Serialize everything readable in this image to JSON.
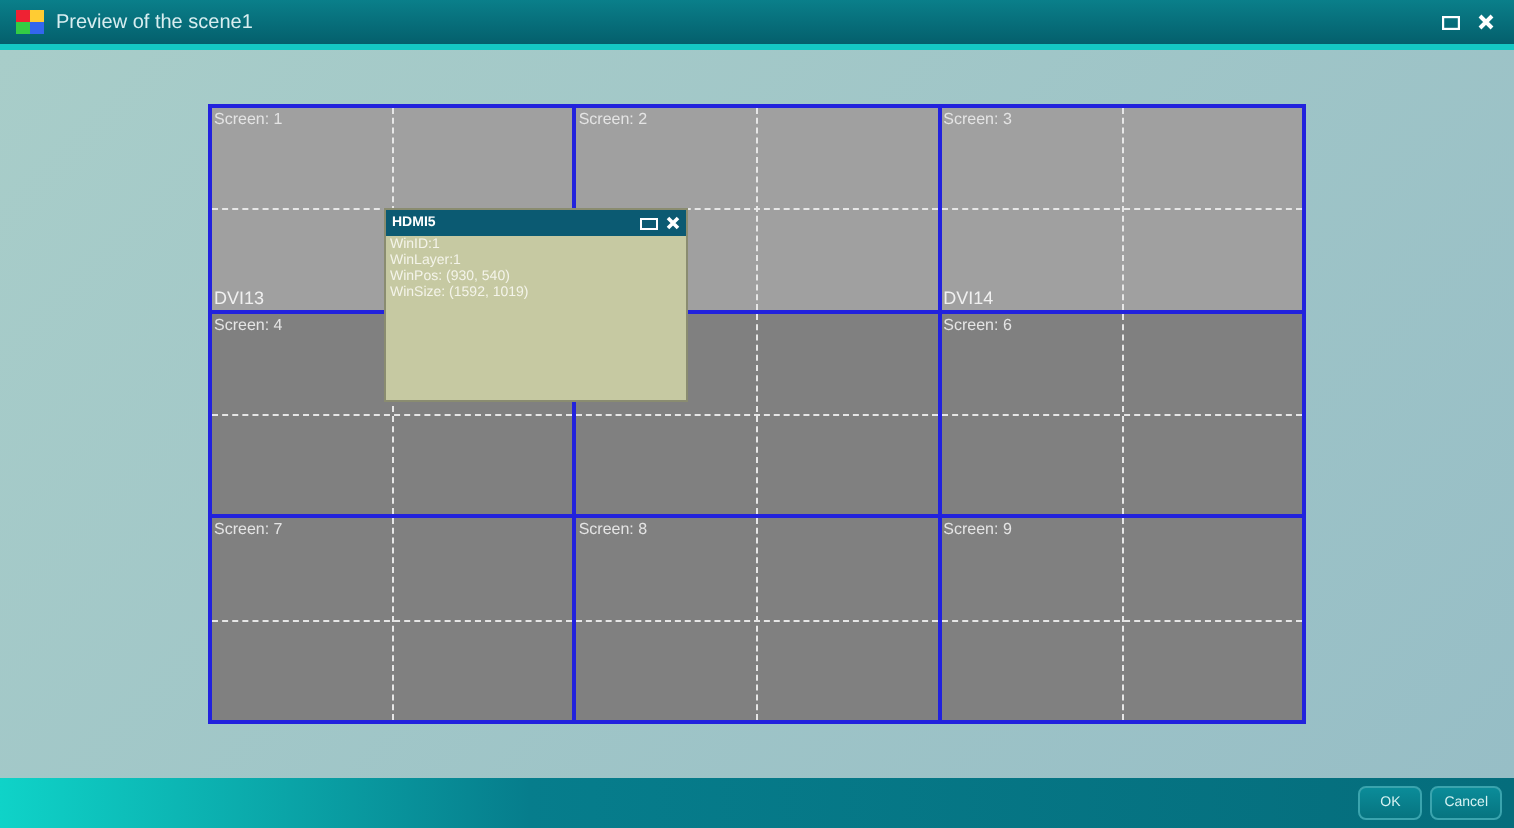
{
  "window": {
    "title": "Preview of the scene1"
  },
  "screens": [
    {
      "label": "Screen: 1",
      "source": "DVI13",
      "lit": true
    },
    {
      "label": "Screen: 2",
      "lit": true
    },
    {
      "label": "Screen: 3",
      "source": "DVI14",
      "lit": true
    },
    {
      "label": "Screen: 4",
      "lit": false
    },
    {
      "lit": false
    },
    {
      "label": "Screen: 6",
      "lit": false
    },
    {
      "label": "Screen: 7",
      "lit": false
    },
    {
      "label": "Screen: 8",
      "lit": false
    },
    {
      "label": "Screen: 9",
      "lit": false
    }
  ],
  "popup": {
    "title": "HDMI5",
    "lines": [
      "WinID:1",
      "WinLayer:1",
      "WinPos: (930, 540)",
      "WinSize: (1592, 1019)"
    ]
  },
  "buttons": [
    "OK",
    "Cancel"
  ]
}
